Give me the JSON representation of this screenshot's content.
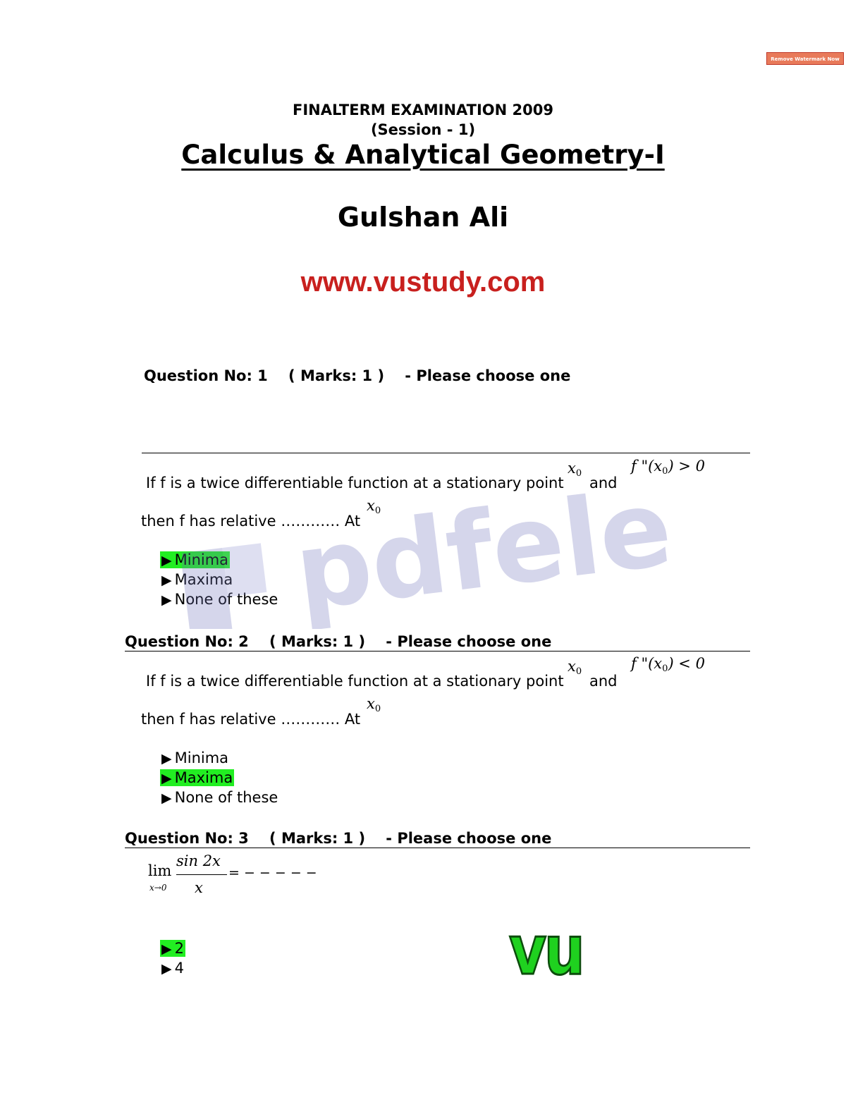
{
  "watermark_button": "Remove Watermark Now",
  "header": {
    "exam_title": "FINALTERM EXAMINATION 2009",
    "session": "(Session - 1)",
    "course_title": "Calculus & Analytical Geometry-I",
    "author": "Gulshan Ali",
    "website": "www.vustudy.com"
  },
  "questions": [
    {
      "heading": "Question No: 1    ( Marks: 1 )    - Please choose one",
      "line1": "If f is a twice differentiable function at a stationary point",
      "and": "and",
      "point": "x",
      "point_sub": "0",
      "condition_lhs": "f \"(x",
      "condition_sub": "0",
      "condition_rhs": ") > 0",
      "line2": "then f has relative ………… At",
      "options": [
        {
          "label": "Minima",
          "selected": true
        },
        {
          "label": "Maxima",
          "selected": false
        },
        {
          "label": "None of these",
          "selected": false
        }
      ]
    },
    {
      "heading": "Question No: 2    ( Marks: 1 )    - Please choose one",
      "line1": "If f is a twice differentiable function at a stationary point",
      "and": "and",
      "point": "x",
      "point_sub": "0",
      "condition_lhs": "f \"(x",
      "condition_sub": "0",
      "condition_rhs": ") < 0",
      "line2": "then f has relative ………… At",
      "options": [
        {
          "label": "Minima",
          "selected": false
        },
        {
          "label": "Maxima",
          "selected": true
        },
        {
          "label": "None of these",
          "selected": false
        }
      ]
    },
    {
      "heading": "Question No: 3    ( Marks: 1 )    - Please choose one",
      "lim": "lim",
      "lim_sub": "x→0",
      "numerator": "sin 2x",
      "denominator": "x",
      "blank": "= − − − − −",
      "options": [
        {
          "label": "2",
          "selected": true
        },
        {
          "label": "4",
          "selected": false
        }
      ]
    }
  ],
  "pdf_watermark": "pdfelement",
  "vu_logo": "vu",
  "colors": {
    "selected_highlight": "#22ee22",
    "website": "#c8201e",
    "vu_logo": "#1fd11f",
    "watermark_button": "#e87a5a"
  }
}
